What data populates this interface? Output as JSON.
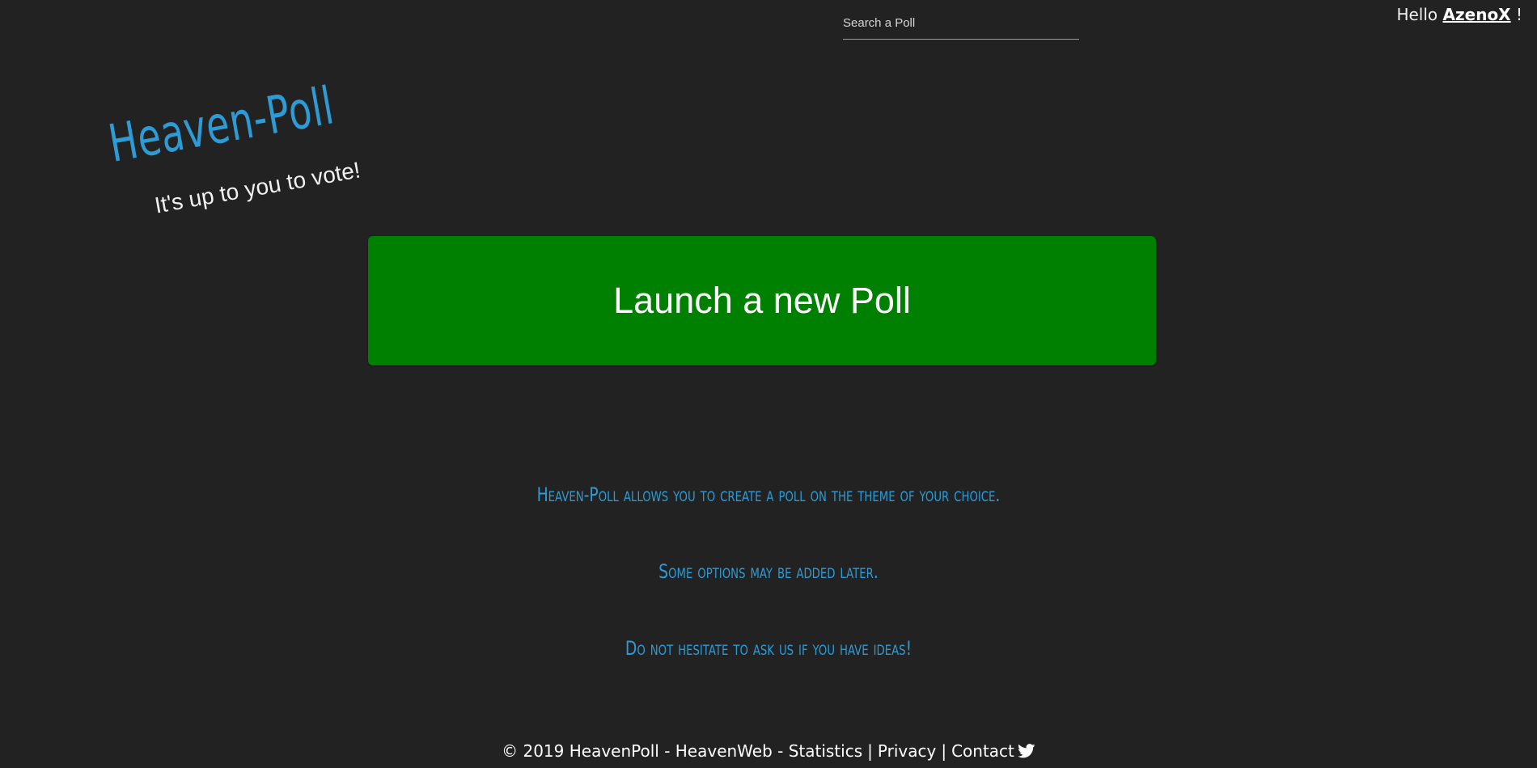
{
  "header": {
    "search": {
      "placeholder": "Search a Poll",
      "value": ""
    },
    "greeting": {
      "prefix": "Hello",
      "username": "AzenoX",
      "suffix": "!"
    }
  },
  "brand": {
    "title": "Heaven-Poll",
    "tagline": "It's up to you to vote!"
  },
  "main": {
    "launch_button_label": "Launch a new Poll",
    "launch_button_color": "#008000",
    "info_lines": [
      "Heaven-Poll allows you to create a poll on the theme of your choice.",
      "Some options may be added later.",
      "Do not hesitate to ask us if you have ideas!"
    ]
  },
  "footer": {
    "copyright": "© 2019 HeavenPoll - HeavenWeb - ",
    "links": {
      "statistics": "Statistics",
      "privacy": "Privacy",
      "contact": "Contact"
    },
    "separator": "|",
    "social_icon": "twitter-icon"
  },
  "colors": {
    "background": "#222222",
    "accent_blue": "#2d9bd6",
    "button_green": "#008000"
  }
}
